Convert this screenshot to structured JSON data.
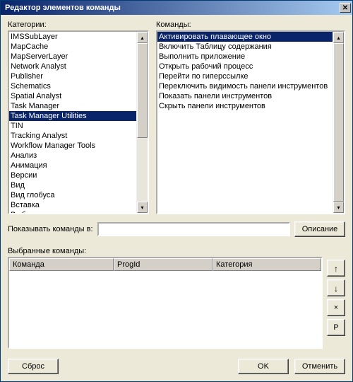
{
  "window": {
    "title": "Редактор элементов команды"
  },
  "labels": {
    "categories": "Категории:",
    "commands": "Команды:",
    "show_in": "Показывать команды в:",
    "selected": "Выбранные команды:"
  },
  "categories": {
    "items": [
      "IMSSubLayer",
      "MapCache",
      "MapServerLayer",
      "Network Analyst",
      "Publisher",
      "Schematics",
      "Spatial Analyst",
      "Task Manager",
      "Task Manager Utilities",
      "TIN",
      "Tracking Analyst",
      "Workflow Manager Tools",
      "Анализ",
      "Анимация",
      "Версии",
      "Вид",
      "Вид глобуса",
      "Вставка",
      "Выборка"
    ],
    "selected_index": 8
  },
  "commands": {
    "items": [
      "Активировать плавающее окно",
      "Включить Таблицу содержания",
      "Выполнить приложение",
      "Открыть рабочий процесс",
      "Перейти по гиперссылке",
      "Переключить видимость панели инструментов",
      "Показать панели инструментов",
      "Скрыть панели инструментов"
    ],
    "selected_index": 0
  },
  "show_in_value": "",
  "table": {
    "columns": [
      "Команда",
      "ProgId",
      "Категория"
    ]
  },
  "buttons": {
    "description": "Описание",
    "reset": "Сброс",
    "ok": "OK",
    "cancel": "Отменить",
    "up": "↑",
    "down": "↓",
    "remove": "×",
    "props": "P"
  }
}
